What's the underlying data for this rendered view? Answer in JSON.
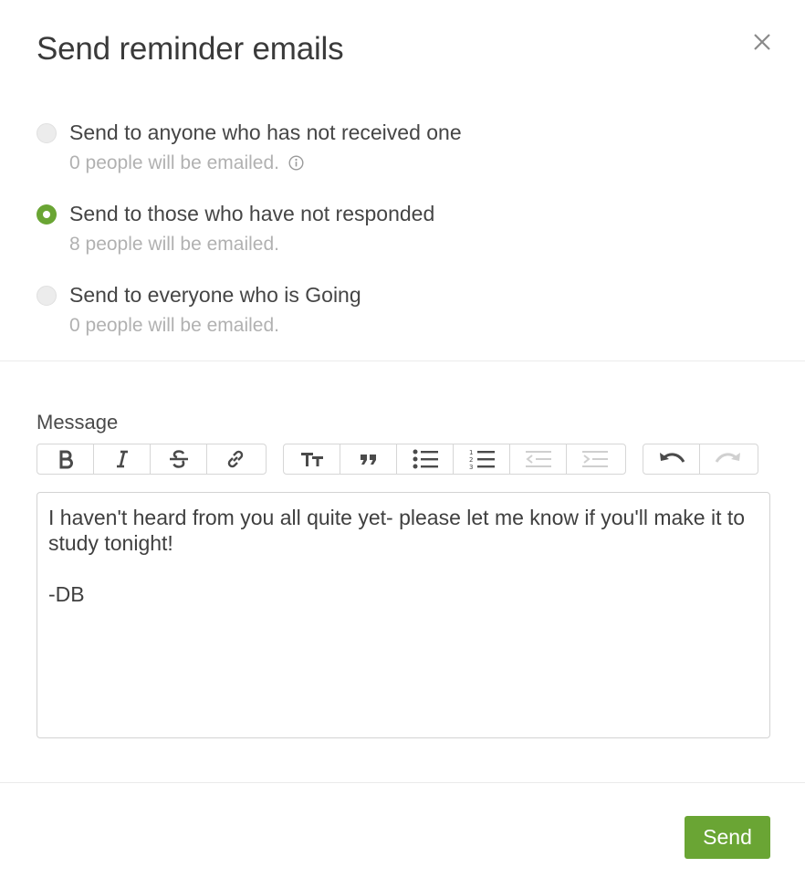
{
  "dialog": {
    "title": "Send reminder emails"
  },
  "options": [
    {
      "label": "Send to anyone who has not received one",
      "sub": "0 people will be emailed.",
      "selected": false,
      "has_info": true
    },
    {
      "label": "Send to those who have not responded",
      "sub": "8 people will be emailed.",
      "selected": true,
      "has_info": false
    },
    {
      "label": "Send to everyone who is Going",
      "sub": "0 people will be emailed.",
      "selected": false,
      "has_info": false
    }
  ],
  "message": {
    "label": "Message",
    "body": "I haven't heard from you all quite yet- please let me know if you'll make it to study tonight!\n\n-DB"
  },
  "toolbar": {
    "groups": [
      [
        "bold-icon",
        "italic-icon",
        "strikethrough-icon",
        "link-icon"
      ],
      [
        "heading-icon",
        "quote-icon",
        "bullet-list-icon",
        "numbered-list-icon",
        "outdent-icon",
        "indent-icon"
      ],
      [
        "undo-icon",
        "redo-icon"
      ]
    ]
  },
  "footer": {
    "send_label": "Send"
  },
  "colors": {
    "accent": "#6aa534",
    "muted_text": "#b1b1b1"
  }
}
